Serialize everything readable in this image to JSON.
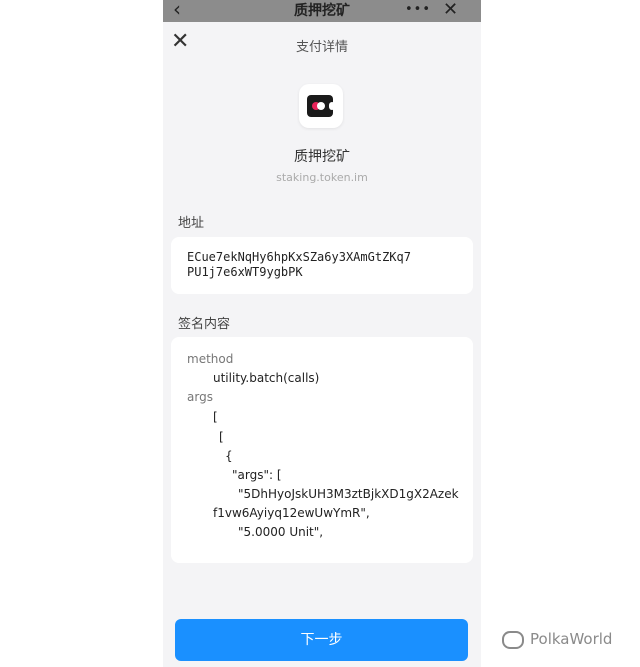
{
  "topbar": {
    "back": "‹",
    "title": "质押挖矿",
    "more": "•••",
    "close": "✕"
  },
  "sheet": {
    "close": "✕",
    "title": "支付详情"
  },
  "app": {
    "name": "质押挖矿",
    "domain": "staking.token.im"
  },
  "address": {
    "label": "地址",
    "line1": "ECue7ekNqHy6hpKxSZa6y3XAmGtZKq7",
    "line2": "PU1j7e6xWT9ygbPK"
  },
  "signature": {
    "label": "签名内容",
    "lines": [
      "method",
      "utility.batch(calls)",
      "args",
      "[",
      "[",
      "{",
      "\"args\": [",
      "\"5DhHyoJskUH3M3ztBjkXD1gX2Azek",
      "f1vw6Ayiyq12ewUwYmR\",",
      "\"5.0000 Unit\","
    ]
  },
  "next_button": "下一步",
  "watermark": "PolkaWorld",
  "colors": {
    "primary": "#1a90ff",
    "accent": "#e8235a",
    "background": "#f4f4f6"
  }
}
